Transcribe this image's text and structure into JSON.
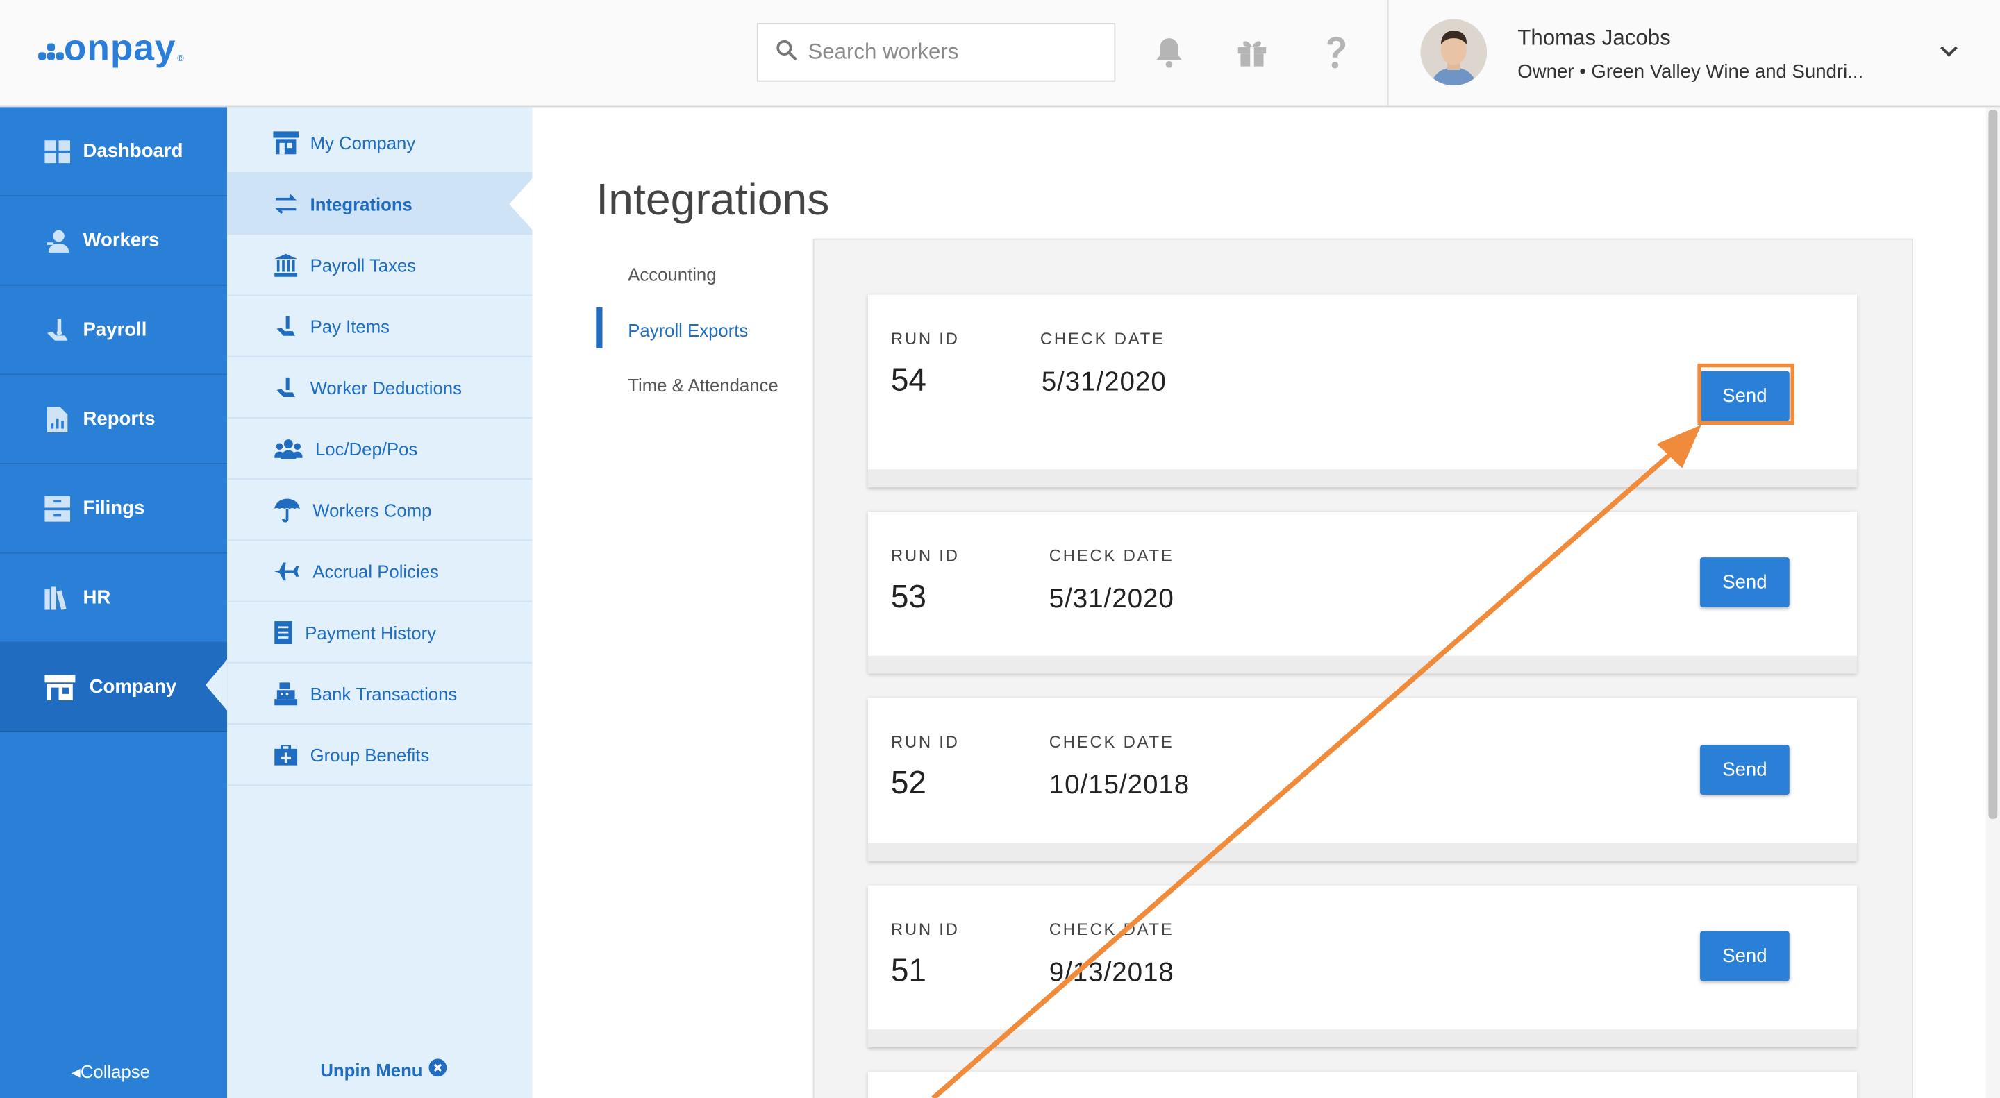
{
  "brand": {
    "name": "onpay",
    "reg": "®",
    "accent": "#2a7fd6",
    "annotation_color": "#ef8b3b"
  },
  "header": {
    "search_placeholder": "Search workers",
    "icons": [
      "bell-icon",
      "gift-icon",
      "help-icon"
    ],
    "user": {
      "name": "Thomas Jacobs",
      "role": "Owner • Green Valley Wine and Sundri..."
    }
  },
  "left_nav": {
    "items": [
      {
        "label": "Dashboard",
        "icon": "dashboard-icon"
      },
      {
        "label": "Workers",
        "icon": "workers-icon"
      },
      {
        "label": "Payroll",
        "icon": "payroll-icon"
      },
      {
        "label": "Reports",
        "icon": "reports-icon"
      },
      {
        "label": "Filings",
        "icon": "filings-icon"
      },
      {
        "label": "HR",
        "icon": "hr-icon"
      },
      {
        "label": "Company",
        "icon": "company-icon",
        "active": true
      }
    ],
    "collapse_label": "Collapse"
  },
  "sub_nav": {
    "items": [
      {
        "label": "My Company",
        "icon": "store-icon"
      },
      {
        "label": "Integrations",
        "icon": "transfer-icon",
        "active": true
      },
      {
        "label": "Payroll Taxes",
        "icon": "bank-icon"
      },
      {
        "label": "Pay Items",
        "icon": "payroll-icon"
      },
      {
        "label": "Worker Deductions",
        "icon": "payroll-icon"
      },
      {
        "label": "Loc/Dep/Pos",
        "icon": "people-icon"
      },
      {
        "label": "Workers Comp",
        "icon": "umbrella-icon"
      },
      {
        "label": "Accrual Policies",
        "icon": "plane-icon"
      },
      {
        "label": "Payment History",
        "icon": "receipt-icon"
      },
      {
        "label": "Bank Transactions",
        "icon": "register-icon"
      },
      {
        "label": "Group Benefits",
        "icon": "medkit-icon"
      }
    ],
    "unpin_label": "Unpin Menu"
  },
  "main": {
    "title": "Integrations",
    "tabs": [
      {
        "label": "Accounting"
      },
      {
        "label": "Payroll Exports",
        "active": true
      },
      {
        "label": "Time & Attendance"
      }
    ],
    "run_id_label": "RUN ID",
    "check_date_label": "CHECK DATE",
    "send_label": "Send",
    "runs": [
      {
        "run_id": "54",
        "check_date": "5/31/2020",
        "highlighted": true
      },
      {
        "run_id": "53",
        "check_date": "5/31/2020"
      },
      {
        "run_id": "52",
        "check_date": "10/15/2018"
      },
      {
        "run_id": "51",
        "check_date": "9/13/2018"
      }
    ]
  }
}
